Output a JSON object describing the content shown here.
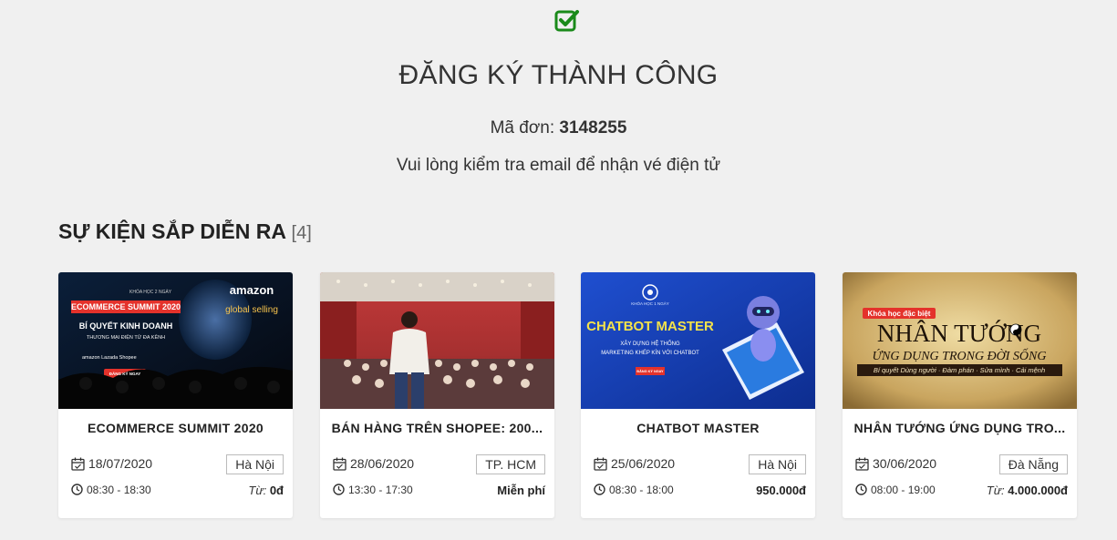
{
  "header": {
    "title": "ĐĂNG KÝ THÀNH CÔNG",
    "order_label": "Mã đơn:",
    "order_id": "3148255",
    "email_note": "Vui lòng kiểm tra email để nhận vé điện tử"
  },
  "section": {
    "title": "SỰ KIỆN SẮP DIỄN RA",
    "count": "[4]"
  },
  "colors": {
    "success": "#1a8a1a"
  },
  "events": [
    {
      "name": "ECOMMERCE SUMMIT 2020",
      "date": "18/07/2020",
      "location": "Hà Nội",
      "time": "08:30 - 18:30",
      "price_prefix": "Từ:",
      "price": "0đ",
      "banner": {
        "label_small": "KHÓA HỌC 2 NGÀY",
        "headline": "ECOMMERCE SUMMIT 2020",
        "sub1": "BÍ QUYẾT KINH DOANH",
        "sub2": "THƯƠNG MẠI ĐIỆN TỬ ĐA KÊNH",
        "brand": "amazon",
        "brand_sub": "global selling",
        "logos": "amazon   Lazada   Shopee",
        "cta": "ĐĂNG KÝ NGAY"
      }
    },
    {
      "name": "BÁN HÀNG TRÊN SHOPEE: 200...",
      "date": "28/06/2020",
      "location": "TP. HCM",
      "time": "13:30 - 17:30",
      "price_free": "Miễn phí"
    },
    {
      "name": "CHATBOT MASTER",
      "date": "25/06/2020",
      "location": "Hà Nội",
      "time": "08:30 - 18:00",
      "price": "950.000đ",
      "banner": {
        "label_small": "KHÓA HỌC 1 NGÀY",
        "headline": "CHATBOT MASTER",
        "sub1": "XÂY DỰNG HỆ THỐNG",
        "sub2": "MARKETING KHÉP KÍN VỚI CHATBOT",
        "cta": "ĐĂNG KÝ NGAY"
      }
    },
    {
      "name": "NHÂN TƯỚNG ỨNG DỤNG TRO...",
      "date": "30/06/2020",
      "location": "Đà Nẵng",
      "time": "08:00 - 19:00",
      "price_prefix": "Từ:",
      "price": "4.000.000đ",
      "banner": {
        "tag": "Khóa học đặc biệt",
        "headline": "NHÂN TƯỚNG",
        "sub1": "ỨNG DỤNG TRONG ĐỜI SỐNG",
        "sub2": "Bí quyết Dùng người · Đàm phán · Sửa mình · Cải mệnh"
      }
    }
  ]
}
